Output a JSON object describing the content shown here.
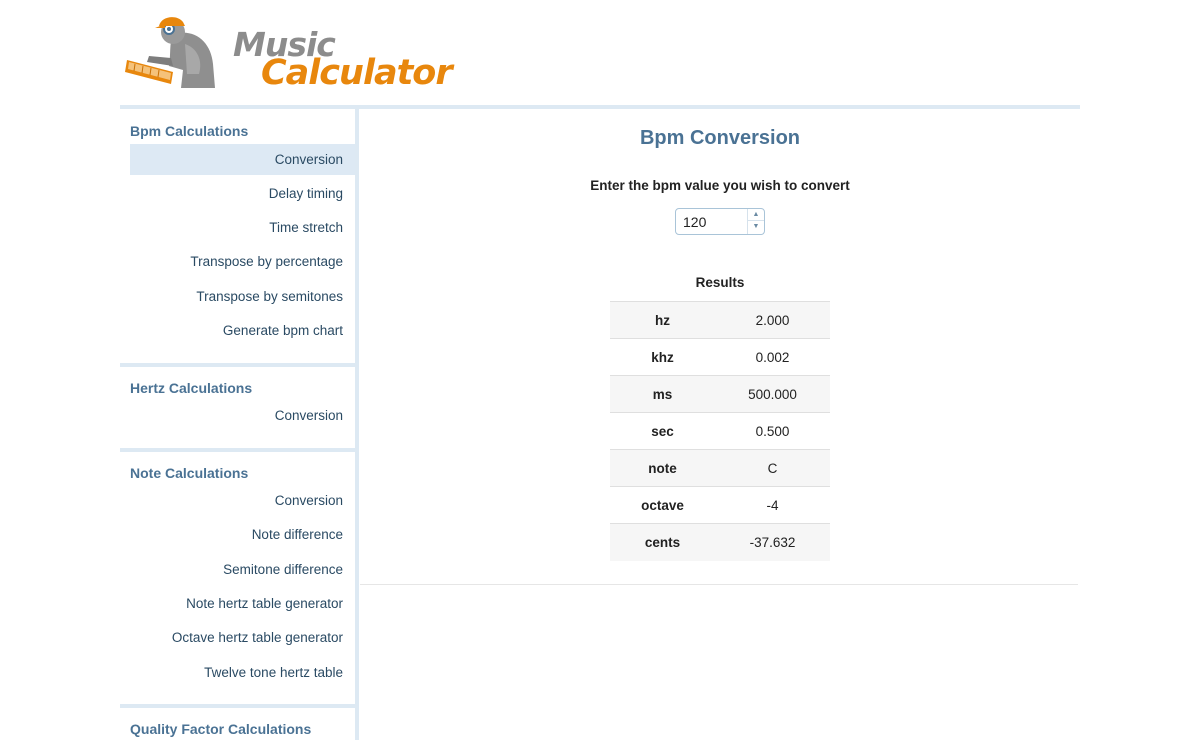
{
  "logo": {
    "line1": "Music",
    "line2": "Calculator"
  },
  "colors": {
    "accent_blue": "#4a7294",
    "logo_orange": "#e8870d",
    "logo_grey": "#8c8c8c",
    "active_bg": "#dde9f4"
  },
  "sidebar": {
    "sections": [
      {
        "title": "Bpm Calculations",
        "items": [
          "Conversion",
          "Delay timing",
          "Time stretch",
          "Transpose by percentage",
          "Transpose by semitones",
          "Generate bpm chart"
        ]
      },
      {
        "title": "Hertz Calculations",
        "items": [
          "Conversion"
        ]
      },
      {
        "title": "Note Calculations",
        "items": [
          "Conversion",
          "Note difference",
          "Semitone difference",
          "Note hertz table generator",
          "Octave hertz table generator",
          "Twelve tone hertz table"
        ]
      },
      {
        "title": "Quality Factor Calculations",
        "items": []
      }
    ]
  },
  "main": {
    "title": "Bpm Conversion",
    "prompt": "Enter the bpm value you wish to convert",
    "bpm_value": "120",
    "results_title": "Results",
    "results": [
      {
        "key": "hz",
        "value": "2.000"
      },
      {
        "key": "khz",
        "value": "0.002"
      },
      {
        "key": "ms",
        "value": "500.000"
      },
      {
        "key": "sec",
        "value": "0.500"
      },
      {
        "key": "note",
        "value": "C"
      },
      {
        "key": "octave",
        "value": "-4"
      },
      {
        "key": "cents",
        "value": "-37.632"
      }
    ]
  }
}
